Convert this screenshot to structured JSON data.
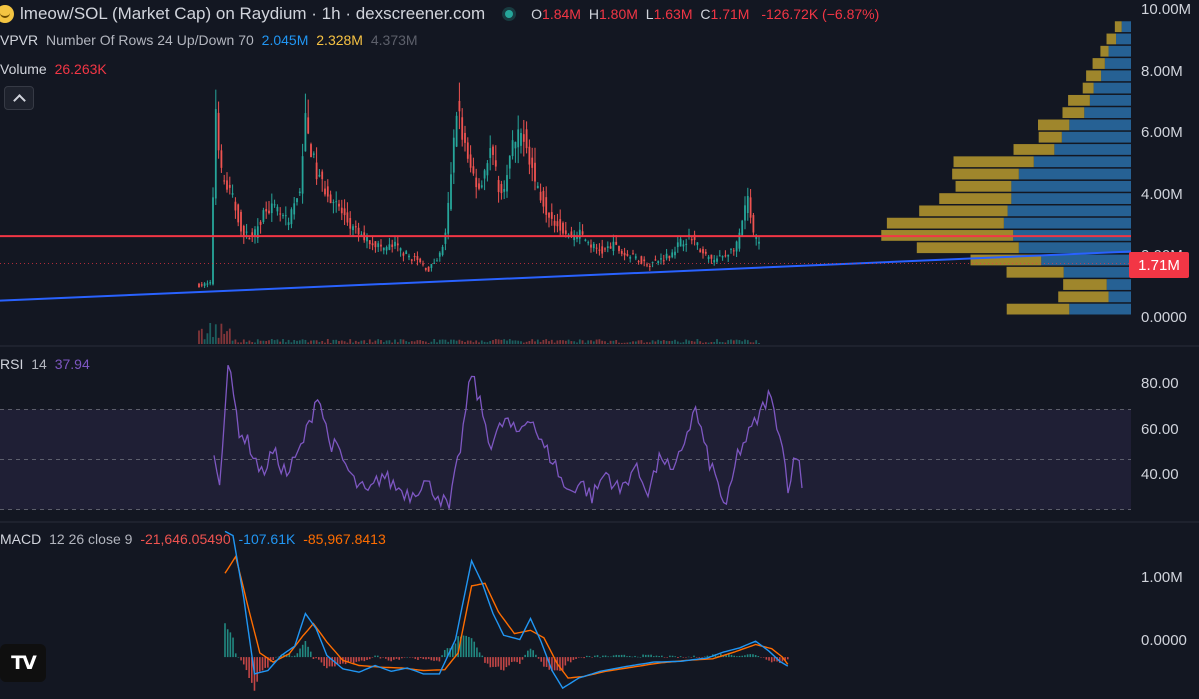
{
  "header": {
    "title": "lmeow/SOL (Market Cap) on Raydium · 1h · dexscreener.com",
    "ohlc": [
      {
        "k": "O",
        "v": "1.84M"
      },
      {
        "k": "H",
        "v": "1.80M"
      },
      {
        "k": "L",
        "v": "1.63M"
      },
      {
        "k": "C",
        "v": "1.71M"
      }
    ],
    "change": "-126.72K (−6.87%)"
  },
  "legends": {
    "vpvr": {
      "label": "VPVR",
      "params": "Number Of Rows 24 Up/Down 70",
      "up": "2.045M",
      "down": "2.328M",
      "total": "4.373M"
    },
    "volume": {
      "label": "Volume",
      "value": "26.263K"
    },
    "rsi": {
      "label": "RSI",
      "params": "14",
      "value": "37.94"
    },
    "macd": {
      "label": "MACD",
      "params": "12 26 close 9",
      "hist": "-21,646.05490",
      "macd": "-107.61K",
      "signal": "-85,967.8413"
    }
  },
  "price_axis": [
    "10.00M",
    "8.00M",
    "6.00M",
    "4.00M",
    "2.00M",
    "0.0000"
  ],
  "rsi_axis": [
    "80.00",
    "60.00",
    "40.00"
  ],
  "macd_axis": [
    "1.00M",
    "0.0000"
  ],
  "last_price_label": "1.71M",
  "logo": "TV",
  "colors": {
    "background": "#131722",
    "up": "#26a69a",
    "down": "#ef5350",
    "rsi_line": "#7e57c2",
    "macd_line": "#2196f3",
    "signal_line": "#ff6d00",
    "trend_line": "#2962ff",
    "hline": "#f23645",
    "vp_up": "#2a6ea8",
    "vp_down": "#b89a2e"
  },
  "chart_data": [
    {
      "type": "candlestick",
      "pane": "price",
      "y_unit": "market cap (USD)",
      "ylim": [
        0,
        10000000
      ],
      "bar_count": 200,
      "close_path": [
        {
          "i": 0,
          "v": 1000000
        },
        {
          "i": 4,
          "v": 1050000
        },
        {
          "i": 6,
          "v": 6800000
        },
        {
          "i": 8,
          "v": 4600000
        },
        {
          "i": 12,
          "v": 3800000
        },
        {
          "i": 16,
          "v": 2600000
        },
        {
          "i": 20,
          "v": 2700000
        },
        {
          "i": 24,
          "v": 3600000
        },
        {
          "i": 28,
          "v": 3400000
        },
        {
          "i": 32,
          "v": 3000000
        },
        {
          "i": 36,
          "v": 4200000
        },
        {
          "i": 38,
          "v": 6300000
        },
        {
          "i": 42,
          "v": 4600000
        },
        {
          "i": 46,
          "v": 4000000
        },
        {
          "i": 50,
          "v": 3500000
        },
        {
          "i": 54,
          "v": 2900000
        },
        {
          "i": 58,
          "v": 2600000
        },
        {
          "i": 62,
          "v": 2400000
        },
        {
          "i": 66,
          "v": 2200000
        },
        {
          "i": 70,
          "v": 2300000
        },
        {
          "i": 74,
          "v": 2000000
        },
        {
          "i": 78,
          "v": 1800000
        },
        {
          "i": 82,
          "v": 1500000
        },
        {
          "i": 86,
          "v": 2000000
        },
        {
          "i": 88,
          "v": 2600000
        },
        {
          "i": 90,
          "v": 4500000
        },
        {
          "i": 92,
          "v": 6900000
        },
        {
          "i": 96,
          "v": 5000000
        },
        {
          "i": 100,
          "v": 4200000
        },
        {
          "i": 104,
          "v": 5400000
        },
        {
          "i": 108,
          "v": 3900000
        },
        {
          "i": 112,
          "v": 5500000
        },
        {
          "i": 116,
          "v": 6000000
        },
        {
          "i": 120,
          "v": 4400000
        },
        {
          "i": 124,
          "v": 3500000
        },
        {
          "i": 128,
          "v": 3000000
        },
        {
          "i": 132,
          "v": 2600000
        },
        {
          "i": 136,
          "v": 2700000
        },
        {
          "i": 140,
          "v": 2300000
        },
        {
          "i": 144,
          "v": 2100000
        },
        {
          "i": 148,
          "v": 2300000
        },
        {
          "i": 152,
          "v": 2000000
        },
        {
          "i": 156,
          "v": 1900000
        },
        {
          "i": 160,
          "v": 1700000
        },
        {
          "i": 164,
          "v": 1800000
        },
        {
          "i": 168,
          "v": 2000000
        },
        {
          "i": 172,
          "v": 2400000
        },
        {
          "i": 176,
          "v": 2600000
        },
        {
          "i": 180,
          "v": 2000000
        },
        {
          "i": 184,
          "v": 1800000
        },
        {
          "i": 188,
          "v": 2000000
        },
        {
          "i": 192,
          "v": 2300000
        },
        {
          "i": 196,
          "v": 3800000
        },
        {
          "i": 198,
          "v": 2600000
        },
        {
          "i": 202,
          "v": 2100000
        },
        {
          "i": 206,
          "v": 2200000
        },
        {
          "i": 210,
          "v": 1710000
        }
      ],
      "hline": 2600000,
      "trendline": [
        {
          "i": -60,
          "v": 500000
        },
        {
          "i": 270,
          "v": 2100000
        }
      ],
      "volume_profile": {
        "rows": [
          {
            "lo": 0,
            "hi": 400000,
            "up": 0.33,
            "down": 0.46
          },
          {
            "lo": 400000,
            "hi": 800000,
            "up": 0.12,
            "down": 0.37
          },
          {
            "lo": 800000,
            "hi": 1200000,
            "up": 0.13,
            "down": 0.32
          },
          {
            "lo": 1200000,
            "hi": 1600000,
            "up": 0.36,
            "down": 0.42
          },
          {
            "lo": 1600000,
            "hi": 2000000,
            "up": 0.48,
            "down": 0.52
          },
          {
            "lo": 2000000,
            "hi": 2400000,
            "up": 0.6,
            "down": 0.75
          },
          {
            "lo": 2400000,
            "hi": 2800000,
            "up": 0.63,
            "down": 0.97
          },
          {
            "lo": 2800000,
            "hi": 3200000,
            "up": 0.68,
            "down": 0.86
          },
          {
            "lo": 3200000,
            "hi": 3600000,
            "up": 0.66,
            "down": 0.65
          },
          {
            "lo": 3600000,
            "hi": 4000000,
            "up": 0.64,
            "down": 0.53
          },
          {
            "lo": 4000000,
            "hi": 4400000,
            "up": 0.64,
            "down": 0.41
          },
          {
            "lo": 4400000,
            "hi": 4800000,
            "up": 0.6,
            "down": 0.49
          },
          {
            "lo": 4800000,
            "hi": 5200000,
            "up": 0.52,
            "down": 0.59
          },
          {
            "lo": 5200000,
            "hi": 5600000,
            "up": 0.41,
            "down": 0.3
          },
          {
            "lo": 5600000,
            "hi": 6000000,
            "up": 0.37,
            "down": 0.17
          },
          {
            "lo": 6000000,
            "hi": 6400000,
            "up": 0.33,
            "down": 0.23
          },
          {
            "lo": 6400000,
            "hi": 6800000,
            "up": 0.25,
            "down": 0.16
          },
          {
            "lo": 6800000,
            "hi": 7200000,
            "up": 0.22,
            "down": 0.16
          },
          {
            "lo": 7200000,
            "hi": 7600000,
            "up": 0.2,
            "down": 0.08
          },
          {
            "lo": 7600000,
            "hi": 8000000,
            "up": 0.16,
            "down": 0.11
          },
          {
            "lo": 8000000,
            "hi": 8400000,
            "up": 0.14,
            "down": 0.09
          },
          {
            "lo": 8400000,
            "hi": 8800000,
            "up": 0.12,
            "down": 0.06
          },
          {
            "lo": 8800000,
            "hi": 9200000,
            "up": 0.08,
            "down": 0.07
          },
          {
            "lo": 9200000,
            "hi": 9600000,
            "up": 0.05,
            "down": 0.05
          }
        ]
      }
    },
    {
      "type": "line",
      "pane": "rsi",
      "ylim": [
        25,
        95
      ],
      "bands": [
        30,
        50,
        70
      ],
      "path": [
        {
          "i": 0,
          "v": 50
        },
        {
          "i": 2,
          "v": 42
        },
        {
          "i": 5,
          "v": 88
        },
        {
          "i": 9,
          "v": 62
        },
        {
          "i": 13,
          "v": 55
        },
        {
          "i": 17,
          "v": 44
        },
        {
          "i": 21,
          "v": 53
        },
        {
          "i": 26,
          "v": 44
        },
        {
          "i": 30,
          "v": 52
        },
        {
          "i": 34,
          "v": 64
        },
        {
          "i": 37,
          "v": 77
        },
        {
          "i": 41,
          "v": 58
        },
        {
          "i": 45,
          "v": 52
        },
        {
          "i": 50,
          "v": 41
        },
        {
          "i": 55,
          "v": 36
        },
        {
          "i": 60,
          "v": 44
        },
        {
          "i": 65,
          "v": 39
        },
        {
          "i": 70,
          "v": 36
        },
        {
          "i": 75,
          "v": 41
        },
        {
          "i": 80,
          "v": 36
        },
        {
          "i": 84,
          "v": 30
        },
        {
          "i": 88,
          "v": 55
        },
        {
          "i": 92,
          "v": 85
        },
        {
          "i": 95,
          "v": 72
        },
        {
          "i": 99,
          "v": 56
        },
        {
          "i": 104,
          "v": 66
        },
        {
          "i": 108,
          "v": 60
        },
        {
          "i": 113,
          "v": 68
        },
        {
          "i": 117,
          "v": 56
        },
        {
          "i": 121,
          "v": 50
        },
        {
          "i": 126,
          "v": 37
        },
        {
          "i": 131,
          "v": 41
        },
        {
          "i": 135,
          "v": 35
        },
        {
          "i": 140,
          "v": 45
        },
        {
          "i": 145,
          "v": 37
        },
        {
          "i": 150,
          "v": 47
        },
        {
          "i": 155,
          "v": 38
        },
        {
          "i": 160,
          "v": 52
        },
        {
          "i": 164,
          "v": 43
        },
        {
          "i": 168,
          "v": 58
        },
        {
          "i": 172,
          "v": 70
        },
        {
          "i": 176,
          "v": 52
        },
        {
          "i": 180,
          "v": 40
        },
        {
          "i": 183,
          "v": 30
        },
        {
          "i": 187,
          "v": 52
        },
        {
          "i": 191,
          "v": 60
        },
        {
          "i": 195,
          "v": 68
        },
        {
          "i": 198,
          "v": 76
        },
        {
          "i": 202,
          "v": 62
        },
        {
          "i": 205,
          "v": 40
        },
        {
          "i": 207,
          "v": 48
        },
        {
          "i": 209,
          "v": 52
        },
        {
          "i": 210,
          "v": 37.94
        }
      ]
    },
    {
      "type": "line",
      "pane": "macd",
      "ylim": [
        -500000,
        1600000
      ],
      "series": [
        {
          "name": "MACD",
          "path": [
            {
              "i": 0,
              "v": 1500000
            },
            {
              "i": 3,
              "v": 1450000
            },
            {
              "i": 7,
              "v": 700000
            },
            {
              "i": 11,
              "v": -200000
            },
            {
              "i": 16,
              "v": -160000
            },
            {
              "i": 21,
              "v": 20000
            },
            {
              "i": 26,
              "v": 130000
            },
            {
              "i": 30,
              "v": 520000
            },
            {
              "i": 34,
              "v": 340000
            },
            {
              "i": 38,
              "v": 20000
            },
            {
              "i": 44,
              "v": -140000
            },
            {
              "i": 50,
              "v": -180000
            },
            {
              "i": 56,
              "v": -100000
            },
            {
              "i": 62,
              "v": -170000
            },
            {
              "i": 68,
              "v": -130000
            },
            {
              "i": 74,
              "v": -200000
            },
            {
              "i": 80,
              "v": -200000
            },
            {
              "i": 86,
              "v": 210000
            },
            {
              "i": 92,
              "v": 1150000
            },
            {
              "i": 96,
              "v": 880000
            },
            {
              "i": 100,
              "v": 520000
            },
            {
              "i": 104,
              "v": 260000
            },
            {
              "i": 110,
              "v": 210000
            },
            {
              "i": 114,
              "v": 460000
            },
            {
              "i": 118,
              "v": 180000
            },
            {
              "i": 122,
              "v": -160000
            },
            {
              "i": 126,
              "v": -370000
            },
            {
              "i": 132,
              "v": -250000
            },
            {
              "i": 140,
              "v": -170000
            },
            {
              "i": 150,
              "v": -110000
            },
            {
              "i": 160,
              "v": -60000
            },
            {
              "i": 170,
              "v": -50000
            },
            {
              "i": 180,
              "v": -10000
            },
            {
              "i": 186,
              "v": 60000
            },
            {
              "i": 192,
              "v": 110000
            },
            {
              "i": 198,
              "v": 190000
            },
            {
              "i": 203,
              "v": 70000
            },
            {
              "i": 207,
              "v": -50000
            },
            {
              "i": 210,
              "v": -107610
            }
          ]
        },
        {
          "name": "Signal",
          "path": [
            {
              "i": 0,
              "v": 1000000
            },
            {
              "i": 4,
              "v": 1200000
            },
            {
              "i": 9,
              "v": 550000
            },
            {
              "i": 13,
              "v": 50000
            },
            {
              "i": 18,
              "v": -60000
            },
            {
              "i": 24,
              "v": 40000
            },
            {
              "i": 29,
              "v": 250000
            },
            {
              "i": 33,
              "v": 400000
            },
            {
              "i": 38,
              "v": 180000
            },
            {
              "i": 44,
              "v": -40000
            },
            {
              "i": 50,
              "v": -100000
            },
            {
              "i": 58,
              "v": -120000
            },
            {
              "i": 66,
              "v": -130000
            },
            {
              "i": 74,
              "v": -160000
            },
            {
              "i": 82,
              "v": -150000
            },
            {
              "i": 87,
              "v": 50000
            },
            {
              "i": 92,
              "v": 850000
            },
            {
              "i": 97,
              "v": 880000
            },
            {
              "i": 102,
              "v": 540000
            },
            {
              "i": 108,
              "v": 280000
            },
            {
              "i": 114,
              "v": 320000
            },
            {
              "i": 119,
              "v": 230000
            },
            {
              "i": 124,
              "v": -80000
            },
            {
              "i": 128,
              "v": -250000
            },
            {
              "i": 134,
              "v": -230000
            },
            {
              "i": 142,
              "v": -170000
            },
            {
              "i": 152,
              "v": -120000
            },
            {
              "i": 162,
              "v": -70000
            },
            {
              "i": 172,
              "v": -40000
            },
            {
              "i": 182,
              "v": -20000
            },
            {
              "i": 190,
              "v": 60000
            },
            {
              "i": 198,
              "v": 150000
            },
            {
              "i": 204,
              "v": 100000
            },
            {
              "i": 208,
              "v": 0
            },
            {
              "i": 210,
              "v": -85967.8413
            }
          ]
        }
      ]
    }
  ]
}
